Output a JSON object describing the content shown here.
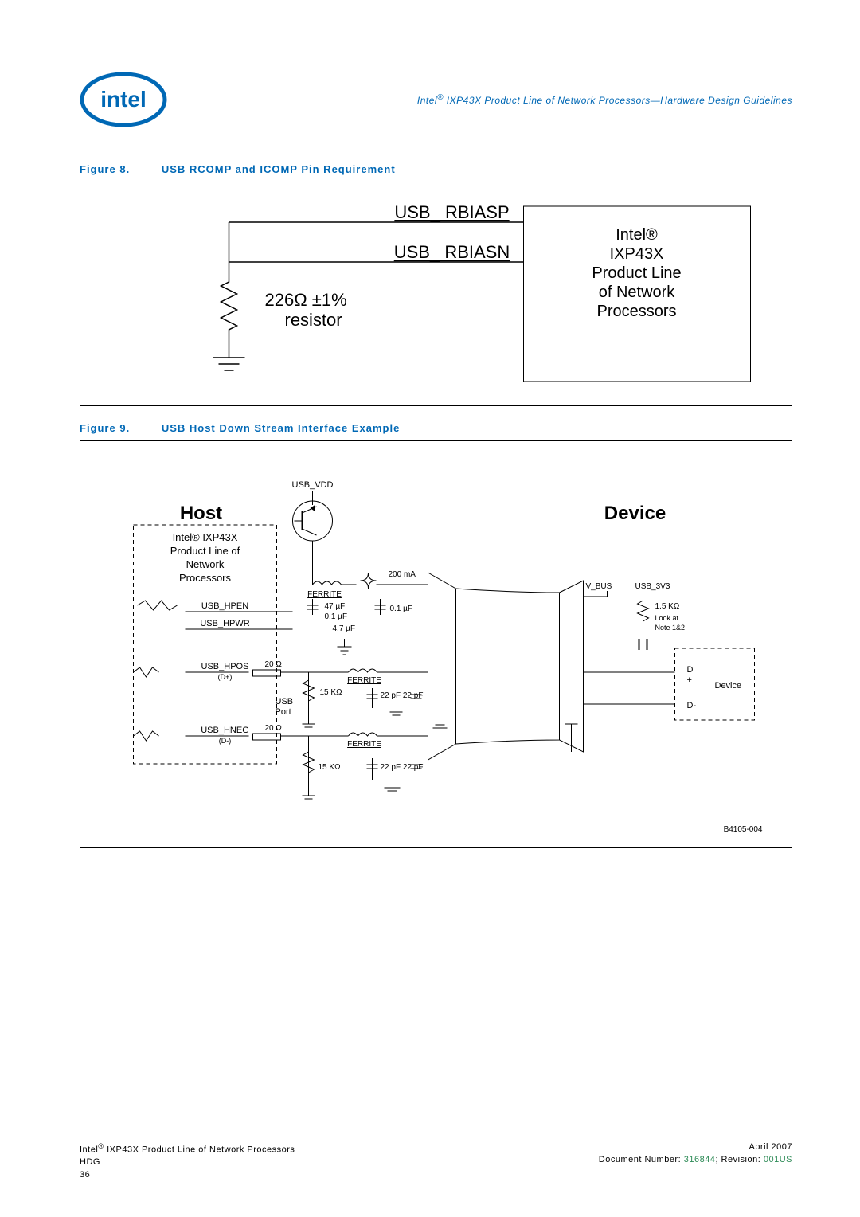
{
  "header": {
    "title_prefix": "Intel",
    "title_suffix": " IXP43X Product Line of Network Processors—Hardware Design Guidelines"
  },
  "figure8": {
    "caption_label": "Figure 8.",
    "caption_title": "USB RCOMP and ICOMP Pin Requirement",
    "signal1": "USB_ RBIASP",
    "signal2": "USB_ RBIASN",
    "resistor_line1": "226Ω  ±1%",
    "resistor_line2": "resistor",
    "chip_line1": "Intel®",
    "chip_line2": "IXP43X",
    "chip_line3": "Product Line",
    "chip_line4": "of Network",
    "chip_line5": "Processors"
  },
  "figure9": {
    "caption_label": "Figure 9.",
    "caption_title": "USB Host Down Stream Interface Example",
    "host_label": "Host",
    "device_label": "Device",
    "chip_l1": "Intel® IXP43X",
    "chip_l2": "Product Line of",
    "chip_l3": "Network",
    "chip_l4": "Processors",
    "usb_vdd": "USB_VDD",
    "ferrite": "FERRITE",
    "current": "200 mA",
    "c47uf": "47 µF",
    "c01uf": "0.1 µF",
    "c47_single": "4.7 µF",
    "usb_hpen": "USB_HPEN",
    "usb_hpwr": "USB_HPWR",
    "usb_hpos": "USB_HPOS",
    "dplus": "(D+)",
    "usb_hneg": "USB_HNEG",
    "dminus": "(D-)",
    "r20": "20 Ω",
    "r15k": "15 KΩ",
    "c22pf": "22 pF  22 pF",
    "usb_port": "USB",
    "port": "Port",
    "vbus": "V_BUS",
    "usb3v3": "USB_3V3",
    "r15k_dev": "1.5 KΩ",
    "note": "Look at",
    "note2": "Note 1&2",
    "dplus_pin": "D",
    "plus": "+",
    "dminus_pin": "D-",
    "device_txt": "Device",
    "partnum": "B4105-004"
  },
  "footer": {
    "left_l1_prefix": "Intel",
    "left_l1_suffix": " IXP43X Product Line of Network Processors",
    "left_l2": "HDG",
    "left_l3": "36",
    "right_l1": "April 2007",
    "right_l2_prefix": "Document Number: ",
    "right_l2_docnum": "316844",
    "right_l2_mid": "; Revision: ",
    "right_l2_rev": "001US"
  }
}
